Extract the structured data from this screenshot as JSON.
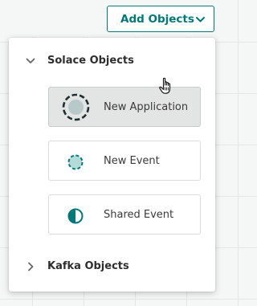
{
  "toolbar": {
    "add_objects_label": "Add Objects"
  },
  "menu": {
    "solace_section": {
      "label": "Solace Objects",
      "expanded": true
    },
    "items": [
      {
        "label": "New Application",
        "icon": "application-icon"
      },
      {
        "label": "New Event",
        "icon": "event-icon"
      },
      {
        "label": "Shared Event",
        "icon": "shared-event-icon"
      }
    ],
    "kafka_section": {
      "label": "Kafka Objects",
      "expanded": false
    }
  },
  "colors": {
    "accent": "#00797a",
    "application_fill": "#b7c9c9",
    "event_fill": "#b3dcd9",
    "shared_event_fill": "#00797a"
  }
}
